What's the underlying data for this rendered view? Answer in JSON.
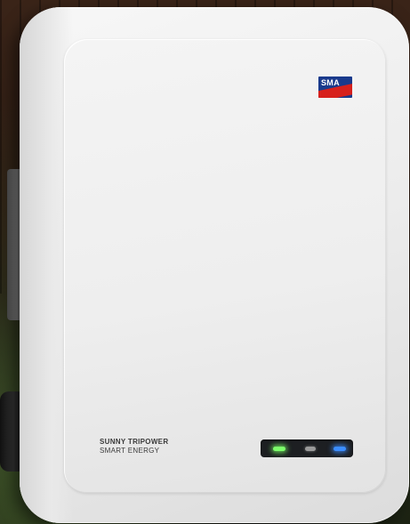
{
  "device": {
    "brand_logo_text": "SMA",
    "product_name": "SUNNY TRIPOWER",
    "product_subtitle": "SMART ENERGY"
  },
  "status_leds": [
    {
      "name": "green",
      "color": "#7cff6a",
      "state": "on"
    },
    {
      "name": "grey",
      "color": "#9a9a9a",
      "state": "off"
    },
    {
      "name": "blue",
      "color": "#3b8dff",
      "state": "on"
    }
  ],
  "colors": {
    "logo_blue": "#1a3a8c",
    "logo_red": "#d7201c",
    "housing_white": "#f4f4f4"
  }
}
